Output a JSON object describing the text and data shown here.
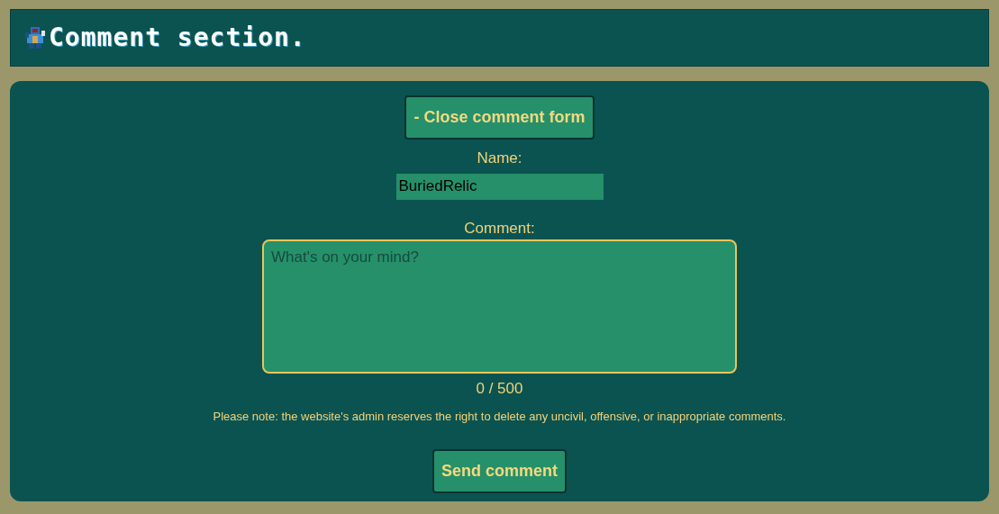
{
  "header": {
    "title": "Comment section."
  },
  "toggle_button": {
    "label": "- Close comment form"
  },
  "name_field": {
    "label": "Name:",
    "value": "BuriedRelic"
  },
  "comment_field": {
    "label": "Comment:",
    "placeholder": "What's on your mind?"
  },
  "counter": "0 / 500",
  "note": "Please note: the website's admin reserves the right to delete any uncivil, offensive, or inappropriate comments.",
  "send_button": {
    "label": "Send comment"
  }
}
